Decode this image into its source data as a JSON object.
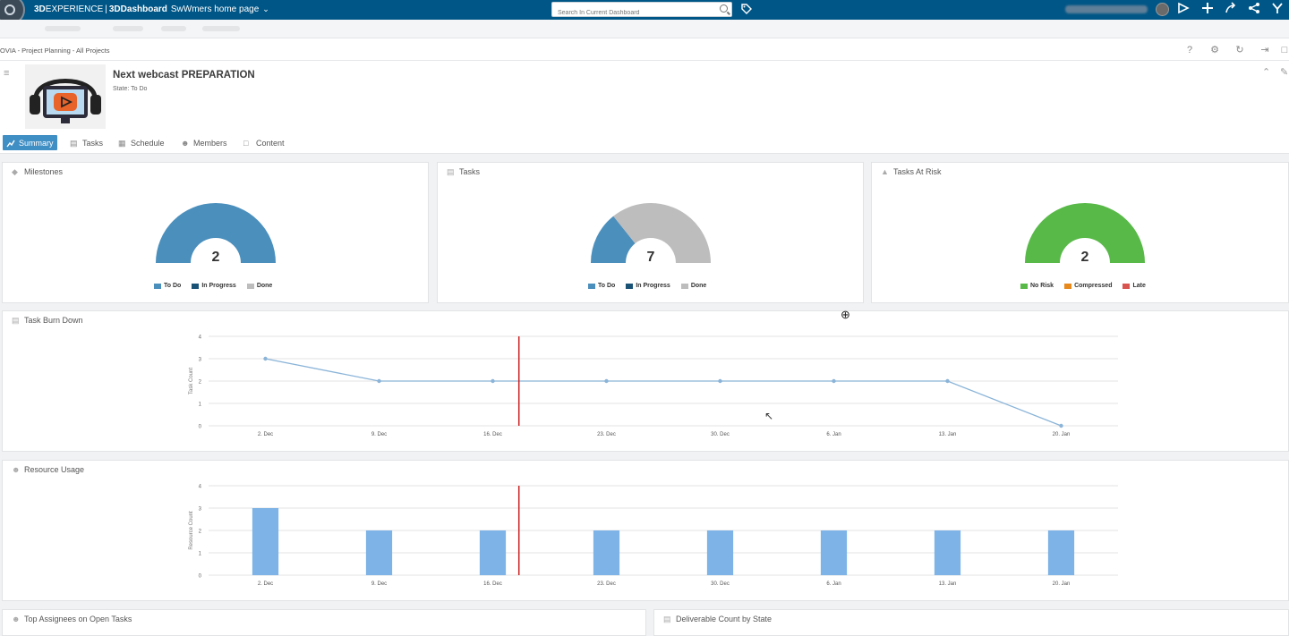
{
  "topbar": {
    "brand_3d": "3D",
    "brand_experience": "EXPERIENCE",
    "brand_sep": "|",
    "brand_dashboard": "3DDashboard",
    "dashboard_name": "SwWmers home page",
    "search_placeholder": "Search In Current Dashboard"
  },
  "breadcrumb": "OVIA - Project Planning - All Projects",
  "project": {
    "title": "Next webcast PREPARATION",
    "state": "State: To Do"
  },
  "tabs": [
    {
      "label": "Summary",
      "icon": "chart-icon"
    },
    {
      "label": "Tasks",
      "icon": "clipboard-icon"
    },
    {
      "label": "Schedule",
      "icon": "calendar-icon"
    },
    {
      "label": "Members",
      "icon": "people-icon"
    },
    {
      "label": "Content",
      "icon": "document-icon"
    }
  ],
  "colors": {
    "todo": "#4b8fbd",
    "in_progress": "#1a5276",
    "done": "#bdbdbd",
    "no_risk": "#58b948",
    "compressed": "#e8891c",
    "late": "#d9534f",
    "line": "#8ab4d8",
    "bar": "#7db3e6",
    "today": "#cc2222",
    "accent": "#005686"
  },
  "cards": {
    "milestones": {
      "title": "Milestones",
      "total": "2",
      "legend": [
        "To Do",
        "In Progress",
        "Done"
      ]
    },
    "tasks": {
      "title": "Tasks",
      "total": "7",
      "legend": [
        "To Do",
        "In Progress",
        "Done"
      ]
    },
    "risk": {
      "title": "Tasks At Risk",
      "total": "2",
      "legend": [
        "No Risk",
        "Compressed",
        "Late"
      ]
    },
    "burndown": {
      "title": "Task Burn Down"
    },
    "resource": {
      "title": "Resource Usage"
    },
    "assignees": {
      "title": "Top Assignees on Open Tasks"
    },
    "deliverable": {
      "title": "Deliverable Count by State"
    }
  },
  "chart_data": [
    {
      "type": "pie",
      "title": "Milestones",
      "categories": [
        "To Do",
        "In Progress",
        "Done"
      ],
      "values": [
        2,
        0,
        0
      ]
    },
    {
      "type": "pie",
      "title": "Tasks",
      "categories": [
        "To Do",
        "In Progress",
        "Done"
      ],
      "values": [
        2,
        0,
        5
      ]
    },
    {
      "type": "pie",
      "title": "Tasks At Risk",
      "categories": [
        "No Risk",
        "Compressed",
        "Late"
      ],
      "values": [
        2,
        0,
        0
      ]
    },
    {
      "type": "line",
      "title": "Task Burn Down",
      "ylabel": "Task Count",
      "categories": [
        "2. Dec",
        "9. Dec",
        "16. Dec",
        "23. Dec",
        "30. Dec",
        "6. Jan",
        "13. Jan",
        "20. Jan"
      ],
      "values": [
        3,
        2,
        2,
        2,
        2,
        2,
        2,
        0
      ],
      "ylim": [
        0,
        4
      ],
      "yticks": [
        "0",
        "1",
        "2",
        "3",
        "4"
      ],
      "grid": true,
      "today_marker": "between 16. Dec and 23. Dec"
    },
    {
      "type": "bar",
      "title": "Resource Usage",
      "ylabel": "Resource Count",
      "categories": [
        "2. Dec",
        "9. Dec",
        "16. Dec",
        "23. Dec",
        "30. Dec",
        "6. Jan",
        "13. Jan",
        "20. Jan"
      ],
      "values": [
        3,
        2,
        2,
        2,
        2,
        2,
        2,
        2
      ],
      "ylim": [
        0,
        4
      ],
      "yticks": [
        "0",
        "1",
        "2",
        "3",
        "4"
      ],
      "grid": true,
      "today_marker": "between 16. Dec and 23. Dec"
    }
  ]
}
